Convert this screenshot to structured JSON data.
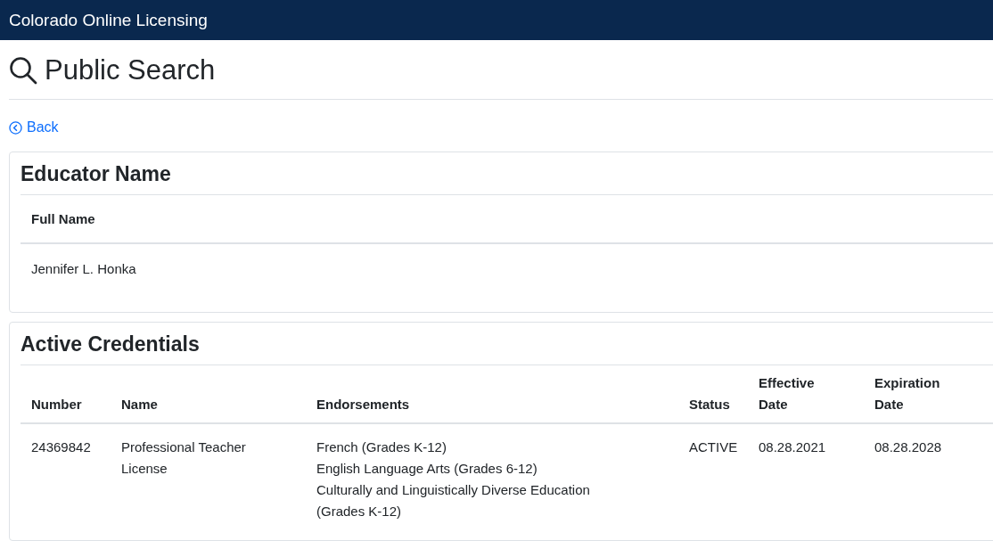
{
  "header": {
    "title": "Colorado Online Licensing"
  },
  "page": {
    "title": "Public Search",
    "back_link": "Back"
  },
  "educator_card": {
    "title": "Educator Name",
    "columns": [
      "Full Name"
    ],
    "rows": [
      [
        "Jennifer L. Honka"
      ]
    ]
  },
  "credentials_card": {
    "title": "Active Credentials",
    "columns": [
      "Number",
      "Name",
      "Endorsements",
      "Status",
      "Effective Date",
      "Expiration Date"
    ],
    "rows": [
      {
        "number": "24369842",
        "name": "Professional Teacher License",
        "endorsements": [
          "French (Grades K-12)",
          "English Language Arts (Grades 6-12)",
          "Culturally and Linguistically Diverse Education (Grades K-12)"
        ],
        "status": "ACTIVE",
        "effective_date": "08.28.2021",
        "expiration_date": "08.28.2028"
      }
    ]
  }
}
